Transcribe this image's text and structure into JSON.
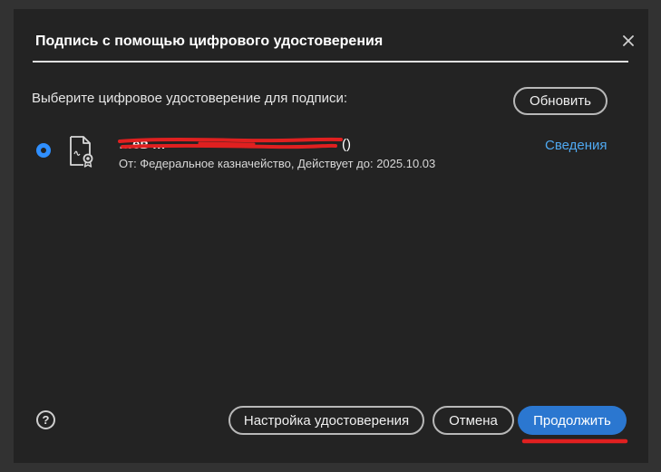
{
  "dialog": {
    "title": "Подпись с помощью цифрового удостоверения",
    "close_icon": "close-icon"
  },
  "prompt": "Выберите цифровое удостоверение для подписи:",
  "refresh_label": "Обновить",
  "certificate": {
    "selected": true,
    "name": "…ев …",
    "name_suffix": "()",
    "issuer_line": "От: Федеральное казначейство, Действует до: 2025.10.03",
    "details_label": "Сведения",
    "icon": "certificate-document-icon"
  },
  "footer": {
    "help_label": "?",
    "settings_label": "Настройка удостоверения",
    "cancel_label": "Отмена",
    "continue_label": "Продолжить"
  },
  "colors": {
    "accent": "#2b77d0",
    "link": "#4fa8f0",
    "annotation": "#e02020"
  }
}
